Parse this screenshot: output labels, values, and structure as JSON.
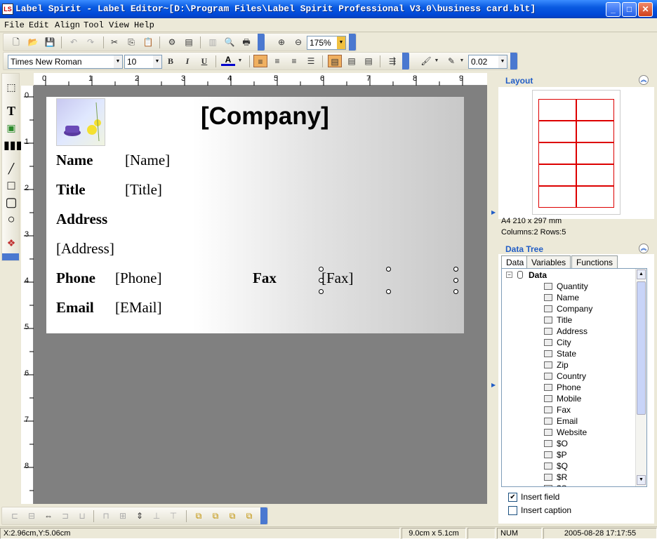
{
  "window": {
    "title": "Label Spirit - Label Editor~[D:\\Program Files\\Label Spirit Professional V3.0\\business card.blt]",
    "min": "_",
    "max": "□",
    "close": "✕"
  },
  "menu": [
    "File",
    "Edit",
    "Align",
    "Tool",
    "View",
    "Help"
  ],
  "toolbar": {
    "zoom": "175%"
  },
  "format_bar": {
    "font": "Times New Roman",
    "size": "10",
    "bold": "B",
    "italic": "I",
    "underline": "U",
    "line_width": "0.02"
  },
  "ruler": {
    "h": [
      "0",
      "1",
      "2",
      "3",
      "4",
      "5",
      "6",
      "7",
      "8",
      "9"
    ],
    "v": [
      "0",
      "1",
      "2",
      "3",
      "4",
      "5",
      "6",
      "7",
      "8"
    ]
  },
  "label": {
    "company": "[Company]",
    "fields": [
      {
        "label": "Name",
        "value": "[Name]"
      },
      {
        "label": "Title",
        "value": "[Title]"
      },
      {
        "label": "Address",
        "value": "[Address]"
      },
      {
        "label": "Phone",
        "value": "[Phone]"
      },
      {
        "label": "Fax",
        "value": "[Fax]"
      },
      {
        "label": "Email",
        "value": "[EMail]"
      }
    ]
  },
  "layout_panel": {
    "title": "Layout",
    "paper": "A4 210 x 297 mm",
    "grid": "Columns:2 Rows:5"
  },
  "data_tree": {
    "title": "Data Tree",
    "tabs": [
      "Data",
      "Variables",
      "Functions"
    ],
    "root": "Data",
    "items": [
      "Quantity",
      "Name",
      "Company",
      "Title",
      "Address",
      "City",
      "State",
      "Zip",
      "Country",
      "Phone",
      "Mobile",
      "Fax",
      "Email",
      "Website",
      "$O",
      "$P",
      "$Q",
      "$R",
      "$S"
    ],
    "insert_field": "Insert field",
    "insert_caption": "Insert caption"
  },
  "status": {
    "coords": "X:2.96cm,Y:5.06cm",
    "size": "9.0cm x 5.1cm",
    "num": "NUM",
    "datetime": "2005-08-28 17:17:55"
  },
  "colors": {
    "title_bar": "#0a5ae0",
    "panel_header": "#215dc6",
    "label_cell_border": "#dd0000"
  }
}
